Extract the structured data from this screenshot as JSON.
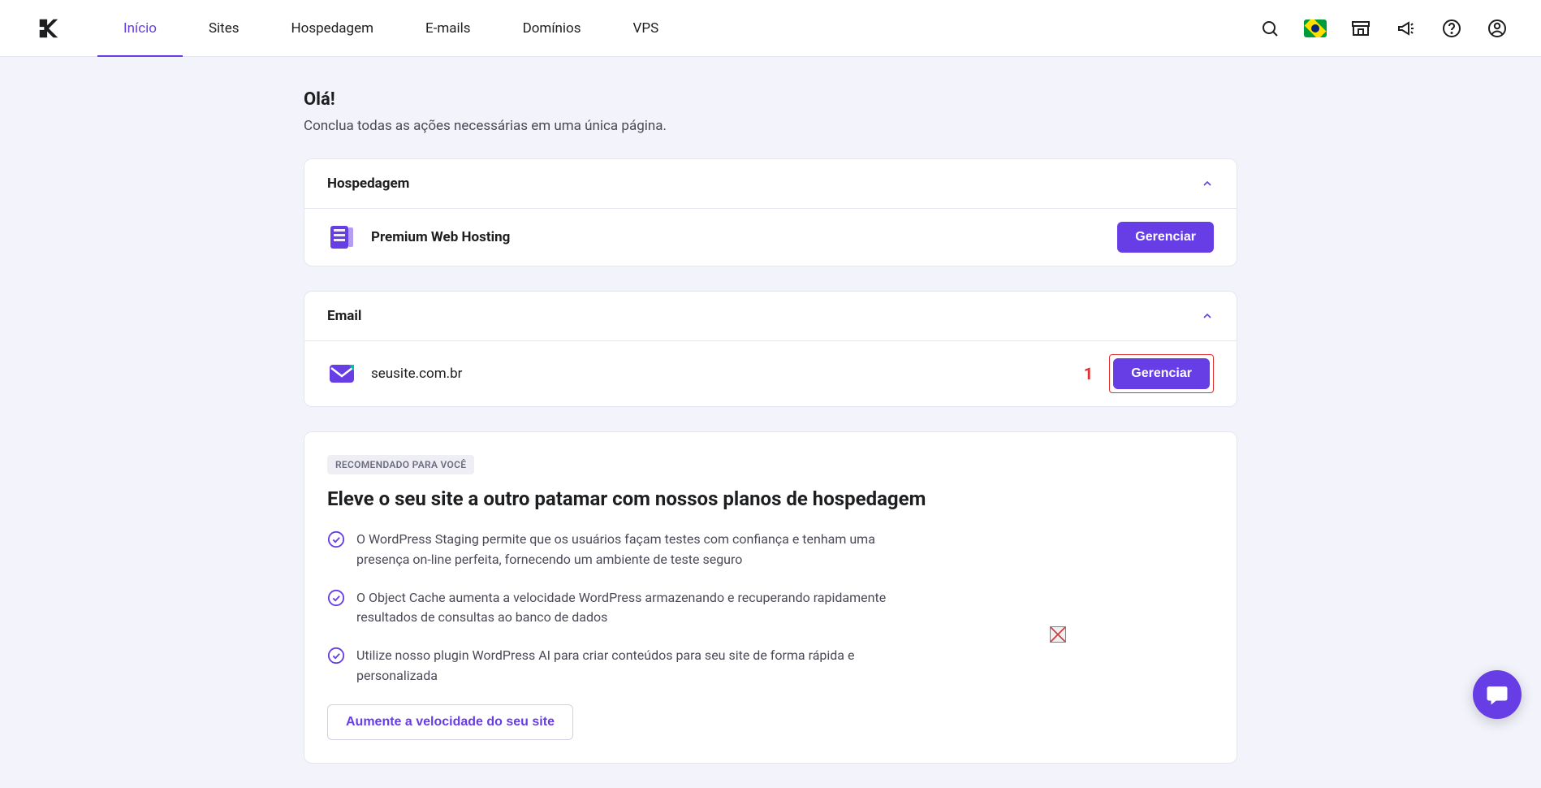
{
  "nav": {
    "items": [
      "Início",
      "Sites",
      "Hospedagem",
      "E-mails",
      "Domínios",
      "VPS"
    ],
    "active_index": 0
  },
  "greeting": "Olá!",
  "subtitle": "Conclua todas as ações necessárias em uma única página.",
  "hosting": {
    "section_title": "Hospedagem",
    "item_label": "Premium Web Hosting",
    "button": "Gerenciar"
  },
  "email": {
    "section_title": "Email",
    "item_label": "seusite.com.br",
    "button": "Gerenciar",
    "annotation_number": "1"
  },
  "reco": {
    "badge": "RECOMENDADO PARA VOCÊ",
    "title": "Eleve o seu site a outro patamar com nossos planos de hospedagem",
    "features": [
      "O WordPress Staging permite que os usuários façam testes com confiança e tenham uma presença on-line perfeita, fornecendo um ambiente de teste seguro",
      "O Object Cache aumenta a velocidade WordPress armazenando e recuperando rapidamente resultados de consultas ao banco de dados",
      "Utilize nosso plugin WordPress AI para criar conteúdos para seu site de forma rápida e personalizada"
    ],
    "cta": "Aumente a velocidade do seu site"
  }
}
